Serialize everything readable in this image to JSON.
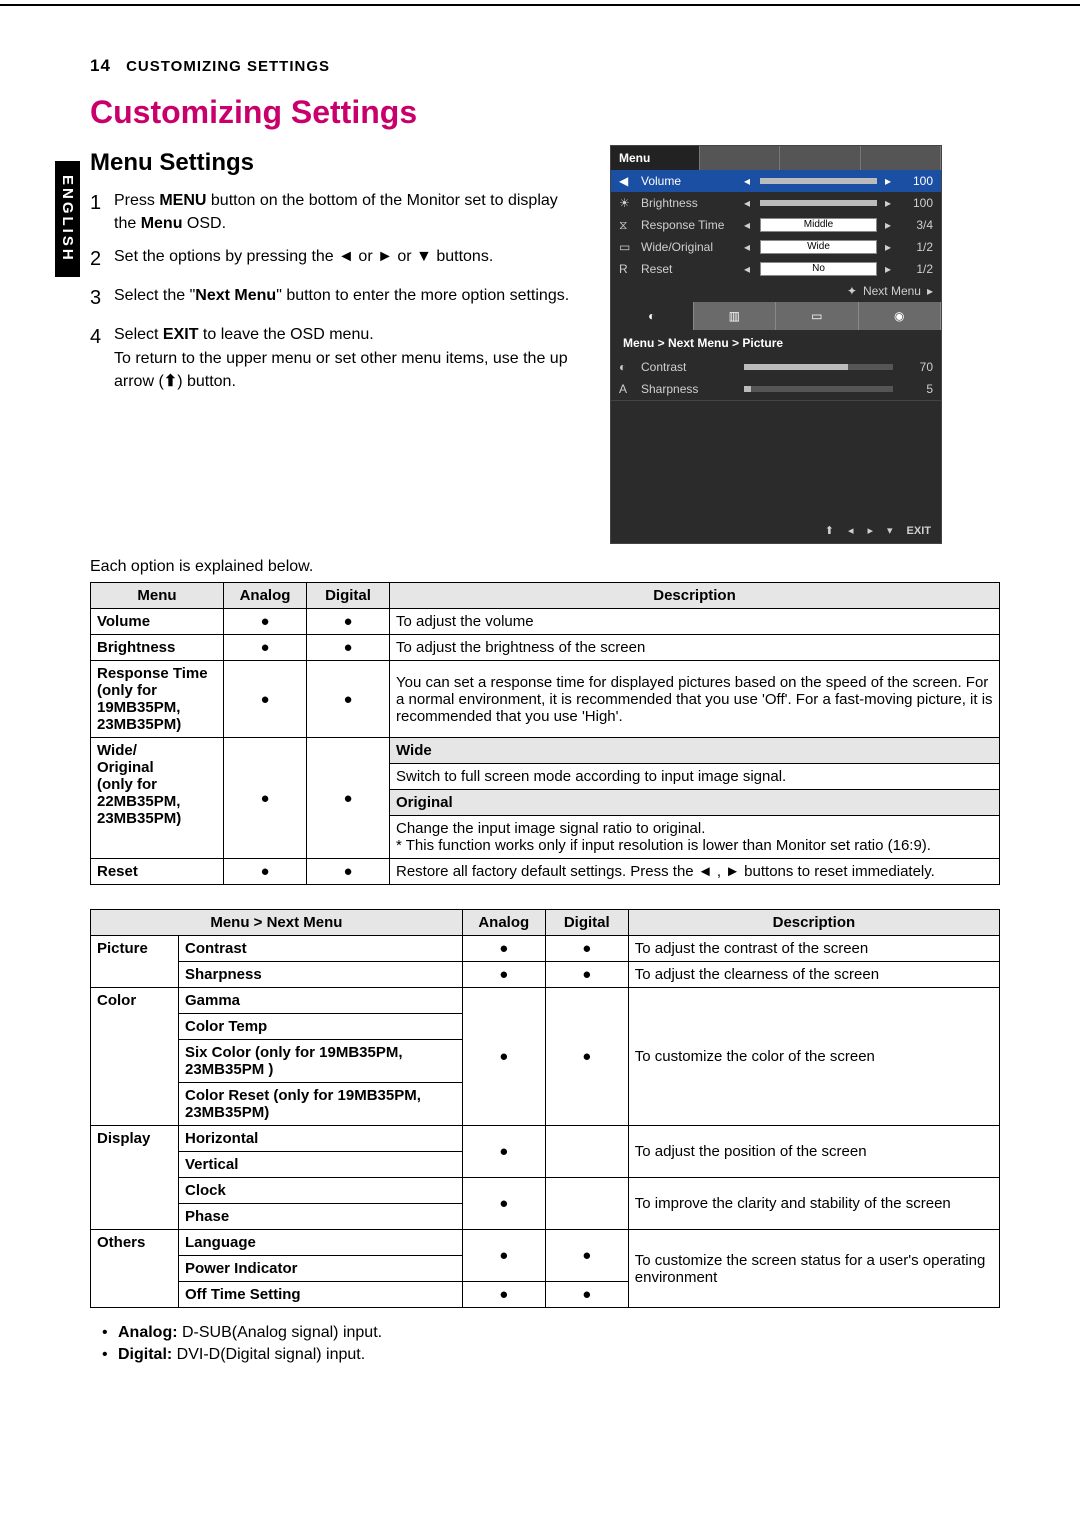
{
  "page_number": "14",
  "header": "CUSTOMIZING SETTINGS",
  "language_tab": "ENGLISH",
  "title": "Customizing Settings",
  "subtitle": "Menu Settings",
  "steps": [
    "Press MENU button on the bottom of the Monitor set to display the Menu OSD.",
    "Set the options by pressing the ◄ or ► or ▼ buttons.",
    "Select the \"Next Menu\" button to enter the more option settings.",
    "Select EXIT to leave the OSD menu.\nTo return to the upper menu or set other menu items, use the up arrow (  ) button."
  ],
  "explain": "Each option is explained below.",
  "osd": {
    "tab": "Menu",
    "rows": [
      {
        "icon": "◀",
        "label": "Volume",
        "type": "bar",
        "val": "100",
        "fill": 100
      },
      {
        "icon": "☀",
        "label": "Brightness",
        "type": "bar",
        "val": "100",
        "fill": 100
      },
      {
        "icon": "⧖",
        "label": "Response Time",
        "type": "pill",
        "pill": "Middle",
        "val": "3/4"
      },
      {
        "icon": "▭",
        "label": "Wide/Original",
        "type": "pill",
        "pill": "Wide",
        "val": "1/2"
      },
      {
        "icon": "R",
        "label": "Reset",
        "type": "pill",
        "pill": "No",
        "val": "1/2"
      }
    ],
    "next_label": "Next Menu",
    "breadcrumb": "Menu  >  Next Menu  >  Picture",
    "sub_rows": [
      {
        "icon": "◐",
        "label": "Contrast",
        "val": "70",
        "fill": 70
      },
      {
        "icon": "A",
        "label": "Sharpness",
        "val": "5",
        "fill": 5
      }
    ],
    "foot": [
      "◂",
      "▸",
      "▾",
      "EXIT"
    ]
  },
  "table1": {
    "headers": [
      "Menu",
      "Analog",
      "Digital",
      "Description"
    ],
    "rows": [
      {
        "m": "Volume",
        "a": "●",
        "d": "●",
        "desc": "To adjust the volume"
      },
      {
        "m": "Brightness",
        "a": "●",
        "d": "●",
        "desc": "To adjust the brightness of the screen"
      },
      {
        "m": "Response Time\n(only for 19MB35PM, 23MB35PM)",
        "a": "●",
        "d": "●",
        "desc": "You can set a response time for displayed pictures based on the speed of the screen. For a normal environment, it is recommended that you use 'Off'. For a fast-moving picture, it is recommended that you use 'High'."
      }
    ],
    "wide_row": {
      "m": "Wide/\nOriginal\n(only for 22MB35PM, 23MB35PM)",
      "a": "●",
      "d": "●",
      "wide_hdr": "Wide",
      "wide_desc": "Switch to full screen mode according to input image signal.",
      "orig_hdr": "Original",
      "orig_desc": "Change the input image signal ratio to original.\n* This function works only if input resolution is lower than Monitor set ratio (16:9)."
    },
    "reset_row": {
      "m": "Reset",
      "a": "●",
      "d": "●",
      "desc": "Restore all factory default settings. Press the ◄ , ► buttons to reset immediately."
    }
  },
  "table2": {
    "headers": [
      "Menu > Next Menu",
      "Analog",
      "Digital",
      "Description"
    ],
    "groups": [
      {
        "cat": "Picture",
        "rows": [
          {
            "m": "Contrast",
            "a": "●",
            "d": "●",
            "desc": "To adjust the contrast of the screen"
          },
          {
            "m": "Sharpness",
            "a": "●",
            "d": "●",
            "desc": "To adjust the clearness of the screen"
          }
        ]
      },
      {
        "cat": "Color",
        "rows": [
          {
            "m": "Gamma"
          },
          {
            "m": "Color Temp"
          },
          {
            "m": "Six Color (only for 19MB35PM, 23MB35PM )"
          },
          {
            "m": "Color Reset (only for 19MB35PM, 23MB35PM)"
          }
        ],
        "a": "●",
        "d": "●",
        "desc": "To customize the color of the screen"
      },
      {
        "cat": "Display",
        "rows": [
          {
            "m": "Horizontal"
          },
          {
            "m": "Vertical"
          },
          {
            "m": "Clock"
          },
          {
            "m": "Phase"
          }
        ],
        "desc1": "To adjust the position of the screen",
        "desc2": "To improve the clarity and stability of the screen",
        "a": "●"
      },
      {
        "cat": "Others",
        "rows": [
          {
            "m": "Language"
          },
          {
            "m": "Power Indicator"
          },
          {
            "m": "Off Time Setting",
            "a2": "●",
            "d2": "●"
          }
        ],
        "a": "●",
        "d": "●",
        "desc": "To customize the screen status for a user's operating environment"
      }
    ]
  },
  "signals": [
    {
      "t": "Analog:",
      "d": "D-SUB(Analog signal) input."
    },
    {
      "t": "Digital:",
      "d": "DVI-D(Digital signal) input."
    }
  ]
}
